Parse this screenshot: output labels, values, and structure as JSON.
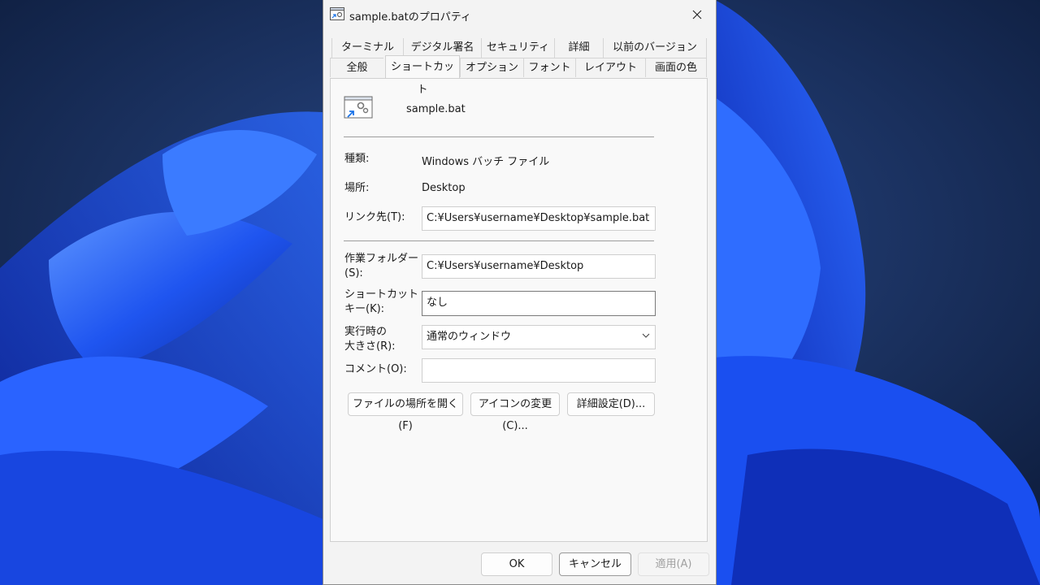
{
  "window": {
    "title": "sample.batのプロパティ",
    "close_icon": "close-icon"
  },
  "tabs": {
    "row1": [
      "ターミナル",
      "デジタル署名",
      "セキュリティ",
      "詳細",
      "以前のバージョン"
    ],
    "row2": [
      "全般",
      "ショートカット",
      "オプション",
      "フォント",
      "レイアウト",
      "画面の色"
    ],
    "active": "ショートカット"
  },
  "file": {
    "name": "sample.bat",
    "icon": "batch-shortcut-icon"
  },
  "fields": {
    "type_label": "種類:",
    "type_value": "Windows バッチ ファイル",
    "location_label": "場所:",
    "location_value": "Desktop",
    "target_label": "リンク先(T):",
    "target_value": "C:¥Users¥username¥Desktop¥sample.bat",
    "workdir_label_1": "作業フォルダー",
    "workdir_label_2": "(S):",
    "workdir_value": "C:¥Users¥username¥Desktop",
    "hotkey_label_1": "ショートカット",
    "hotkey_label_2": "キー(K):",
    "hotkey_value": "なし",
    "run_label_1": "実行時の",
    "run_label_2": "大きさ(R):",
    "run_value": "通常のウィンドウ",
    "comment_label": "コメント(O):",
    "comment_value": ""
  },
  "buttons": {
    "open_location": "ファイルの場所を開く(F)",
    "change_icon": "アイコンの変更(C)...",
    "advanced": "詳細設定(D)...",
    "ok": "OK",
    "cancel": "キャンセル",
    "apply": "適用(A)"
  },
  "colors": {
    "wallpaper_bg": "#0a1733",
    "wallpaper_accent": "#1e5bff",
    "dialog_bg": "#f3f3f3"
  }
}
